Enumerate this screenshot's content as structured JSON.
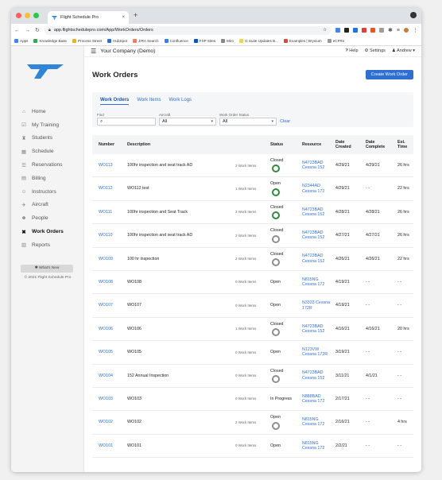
{
  "browser": {
    "tab_title": "Flight Schedule Pro",
    "tab_close": "×",
    "new_tab": "+",
    "url": "app.flightschedulepro.com/App/WorkOrders/Orders",
    "bookmarks": [
      "Apps",
      "Knowledge Base",
      "Process Street",
      "HubSpot",
      "JIRA Search",
      "Confluence",
      "FSP Sites",
      "Miro",
      "G Suite Updates B...",
      "Examples | Brynium",
      "eCFRs"
    ],
    "bookmark_colors": [
      "#4285f4",
      "#34a853",
      "#f4b400",
      "#1a73e8",
      "#ff7a59",
      "#2684ff",
      "#0052cc",
      "#888888",
      "#ffd02f",
      "#ea4335",
      "#999999",
      "#666666"
    ]
  },
  "topbar": {
    "company": "Your Company (Demo)",
    "help": "Help",
    "settings": "Settings",
    "user": "Andrew"
  },
  "sidebar": {
    "items": [
      {
        "label": "Home",
        "icon": "home-icon",
        "glyph": "⌂"
      },
      {
        "label": "My Training",
        "icon": "checkbox-icon",
        "glyph": "☑"
      },
      {
        "label": "Students",
        "icon": "student-icon",
        "glyph": "♜"
      },
      {
        "label": "Schedule",
        "icon": "calendar-icon",
        "glyph": "▦"
      },
      {
        "label": "Reservations",
        "icon": "list-icon",
        "glyph": "☰"
      },
      {
        "label": "Billing",
        "icon": "billing-icon",
        "glyph": "▤"
      },
      {
        "label": "Instructors",
        "icon": "instructor-icon",
        "glyph": "☺"
      },
      {
        "label": "Aircraft",
        "icon": "plane-icon",
        "glyph": "✈"
      },
      {
        "label": "People",
        "icon": "people-icon",
        "glyph": "☻"
      },
      {
        "label": "Work Orders",
        "icon": "wrench-icon",
        "glyph": "✖"
      },
      {
        "label": "Reports",
        "icon": "chart-icon",
        "glyph": "▥"
      }
    ],
    "active_index": 9,
    "whats_new": "✱ What's New",
    "copyright": "© 2021 Flight Schedule Pro"
  },
  "page": {
    "title": "Work Orders",
    "create_button": "Create Work Order",
    "tabs": [
      "Work Orders",
      "Work Items",
      "Work Logs"
    ],
    "filters": {
      "find_label": "Find",
      "aircraft_label": "Aircraft",
      "aircraft_value": "All",
      "status_label": "Work Order Status",
      "status_value": "All",
      "clear": "Clear"
    }
  },
  "table": {
    "headers": [
      "Number",
      "Description",
      "Status",
      "Resource",
      "Date Created",
      "Date Complete",
      "Est. Time"
    ],
    "rows": [
      {
        "number": "WO113",
        "desc": "100hr inspection and seat track AD",
        "items": "3 Work Items",
        "status": "Closed",
        "ring": "green",
        "resource": "N4723BAD Cessna 152",
        "created": "4/29/21",
        "complete": "4/29/21",
        "est": "26 hrs"
      },
      {
        "number": "WO112",
        "desc": "WO112 test",
        "items": "1 Work Items",
        "status": "Open",
        "ring": "green",
        "resource": "N2344AD Cessna 172",
        "created": "4/29/21",
        "complete": "- -",
        "est": "22 hrs"
      },
      {
        "number": "WO111",
        "desc": "100hr inspection and Seat Track",
        "items": "3 Work Items",
        "status": "Closed",
        "ring": "green",
        "resource": "N4723BAD Cessna 152",
        "created": "4/28/21",
        "complete": "4/28/21",
        "est": "26 hrs"
      },
      {
        "number": "WO110",
        "desc": "100hr inspection and seat track AD",
        "items": "3 Work Items",
        "status": "Closed",
        "ring": "grey",
        "resource": "N4723BAD Cessna 152",
        "created": "4/27/21",
        "complete": "4/27/21",
        "est": "26 hrs"
      },
      {
        "number": "WO109",
        "desc": "100 hr inspection",
        "items": "2 Work Items",
        "status": "Closed",
        "ring": "grey",
        "resource": "N4723BAD Cessna 152",
        "created": "4/26/21",
        "complete": "4/26/21",
        "est": "22 hrs"
      },
      {
        "number": "WO108",
        "desc": "WO108",
        "items": "0 Work Items",
        "status": "Open",
        "ring": "",
        "resource": "N815NG Cessna 172",
        "created": "4/19/21",
        "complete": "- -",
        "est": "- -"
      },
      {
        "number": "WO107",
        "desc": "WO107",
        "items": "0 Work Items",
        "status": "Open",
        "ring": "",
        "resource": "N3333 Cessna 172R",
        "created": "4/19/21",
        "complete": "- -",
        "est": "- -"
      },
      {
        "number": "WO106",
        "desc": "WO106",
        "items": "1 Work Items",
        "status": "Closed",
        "ring": "grey",
        "resource": "N4723BAD Cessna 152",
        "created": "4/16/21",
        "complete": "4/16/21",
        "est": "20 hrs"
      },
      {
        "number": "WO105",
        "desc": "WO105",
        "items": "0 Work Items",
        "status": "Open",
        "ring": "",
        "resource": "N123VW Cessna 172R",
        "created": "3/19/21",
        "complete": "- -",
        "est": "- -"
      },
      {
        "number": "WO104",
        "desc": "152 Annual Inspection",
        "items": "0 Work Items",
        "status": "Closed",
        "ring": "grey",
        "resource": "N4723BAD Cessna 152",
        "created": "3/11/21",
        "complete": "4/1/21",
        "est": "- -"
      },
      {
        "number": "WO103",
        "desc": "WO103",
        "items": "0 Work Items",
        "status": "In Progress",
        "ring": "",
        "resource": "N888BAD Cessna 172",
        "created": "2/17/21",
        "complete": "- -",
        "est": "- -"
      },
      {
        "number": "WO102",
        "desc": "WO102",
        "items": "2 Work Items",
        "status": "Open",
        "ring": "grey",
        "resource": "N815NG Cessna 172",
        "created": "2/16/21",
        "complete": "- -",
        "est": "4 hrs"
      },
      {
        "number": "WO101",
        "desc": "WO101",
        "items": "0 Work Items",
        "status": "Open",
        "ring": "",
        "resource": "N815NG Cessna 172",
        "created": "2/2/21",
        "complete": "- -",
        "est": "- -"
      }
    ]
  }
}
